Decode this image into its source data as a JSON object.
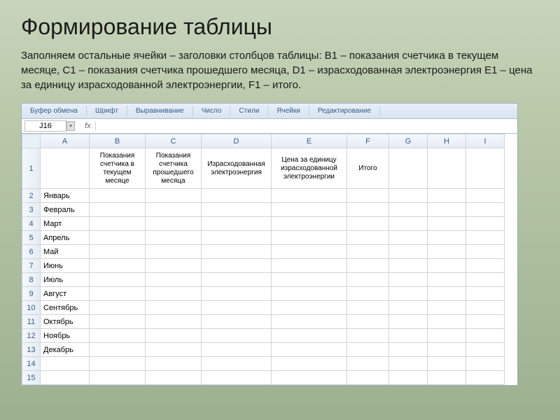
{
  "slide": {
    "title": "Формирование таблицы",
    "description": "Заполняем остальные ячейки – заголовки столбцов таблицы: В1 – показания счетчика в текущем месяце, С1 – показания счетчика прошедшего месяца, D1 – израсходованная электроэнергия E1 – цена за единицу израсходованной электроэнергии, F1 – итого."
  },
  "ribbon": {
    "tabs": [
      "Буфер обмена",
      "Шрифт",
      "Выравнивание",
      "Число",
      "Стили",
      "Ячейки",
      "Редактирование"
    ]
  },
  "namebox": {
    "cell": "J16",
    "fx": "fx"
  },
  "columns": [
    "A",
    "B",
    "C",
    "D",
    "E",
    "F",
    "G",
    "H",
    "I"
  ],
  "headers": {
    "B1": "Показания счетчика в текущем месяце",
    "C1": "Показания счетчика прошедшего месяца",
    "D1": "Израсходованная электроэнергия",
    "E1": "Цена за единицу израсходованной электроэнергии",
    "F1": "Итого"
  },
  "rows": [
    {
      "n": 2,
      "A": "Январь"
    },
    {
      "n": 3,
      "A": "Февраль"
    },
    {
      "n": 4,
      "A": "Март"
    },
    {
      "n": 5,
      "A": "Апрель"
    },
    {
      "n": 6,
      "A": "Май"
    },
    {
      "n": 7,
      "A": "Июнь"
    },
    {
      "n": 8,
      "A": "Июль"
    },
    {
      "n": 9,
      "A": "Август"
    },
    {
      "n": 10,
      "A": "Сентябрь"
    },
    {
      "n": 11,
      "A": "Октябрь"
    },
    {
      "n": 12,
      "A": "Ноябрь"
    },
    {
      "n": 13,
      "A": "Декабрь"
    },
    {
      "n": 14,
      "A": ""
    },
    {
      "n": 15,
      "A": ""
    }
  ]
}
